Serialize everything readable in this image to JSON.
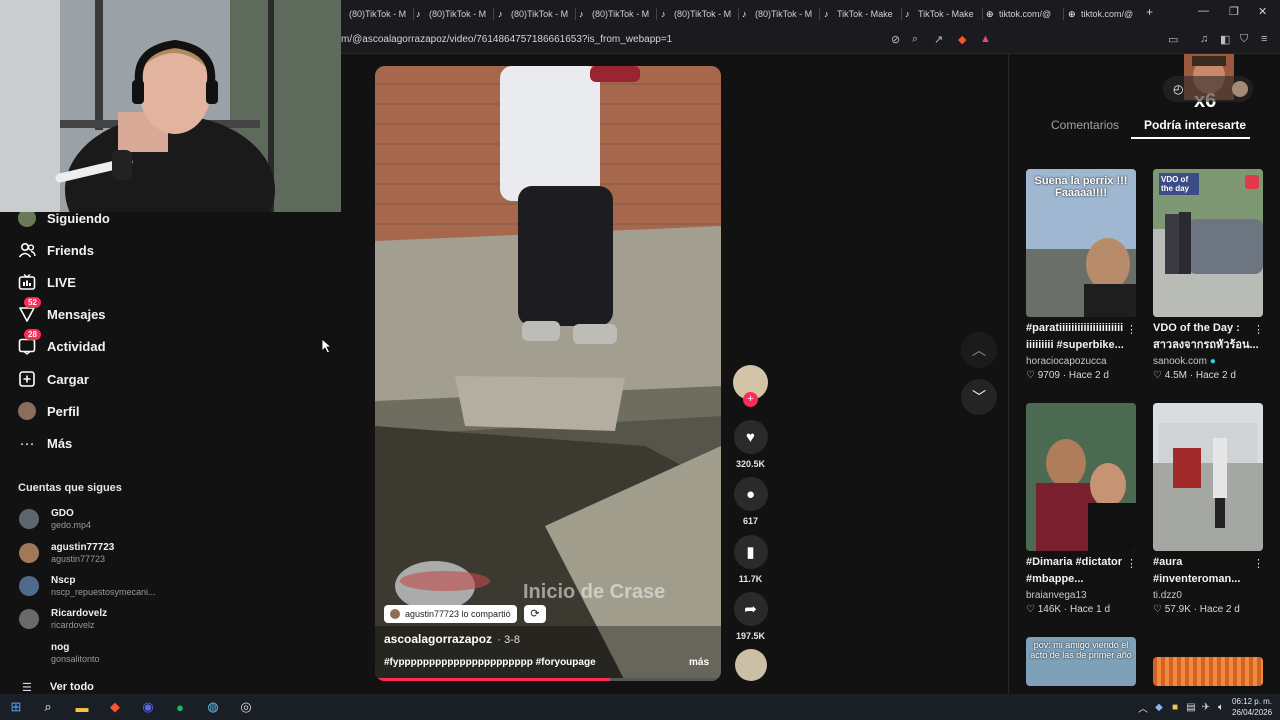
{
  "browser": {
    "tabs": [
      {
        "label": "(80)TikTok - M"
      },
      {
        "label": "(80)TikTok - M"
      },
      {
        "label": "(80)TikTok - M"
      },
      {
        "label": "(80)TikTok - M"
      },
      {
        "label": "(80)TikTok - M"
      },
      {
        "label": "(80)TikTok - M"
      },
      {
        "label": "TikTok - Make"
      },
      {
        "label": "TikTok - Make"
      },
      {
        "label": "tiktok.com/@"
      },
      {
        "label": "tiktok.com/@"
      }
    ],
    "new_tab": "+",
    "url": "m/@ascoalagorrazapoz/video/7614864757186661653?is_from_webapp=1"
  },
  "sidebar": {
    "items": [
      {
        "label": "Siguiendo",
        "icon": "avatar"
      },
      {
        "label": "Friends",
        "icon": "friends-icon"
      },
      {
        "label": "LIVE",
        "icon": "live-icon"
      },
      {
        "label": "Mensajes",
        "icon": "messages-icon",
        "badge": "52"
      },
      {
        "label": "Actividad",
        "icon": "activity-icon",
        "badge": "28"
      },
      {
        "label": "Cargar",
        "icon": "upload-icon"
      },
      {
        "label": "Perfil",
        "icon": "profile-avatar"
      },
      {
        "label": "Más",
        "icon": "more-icon"
      }
    ],
    "following_title": "Cuentas que sigues",
    "accounts": [
      {
        "name": "GDO",
        "handle": "gedo.mp4"
      },
      {
        "name": "agustin77723",
        "handle": "agustin77723"
      },
      {
        "name": "Nscp",
        "handle": "nscp_repuestosymecani..."
      },
      {
        "name": "Ricardovelz",
        "handle": "ricardovelz"
      },
      {
        "name": "nog",
        "handle": "gonsalitonto"
      }
    ],
    "see_all": "Ver todo"
  },
  "video": {
    "overlay_text": "Inicio de Crase",
    "shared_by": "agustin77723 lo compartió",
    "author": "ascoalagorrazapoz",
    "date": "· 3-8",
    "caption": "#fypppppppppppppppppppppp #foryoupage",
    "more": "más",
    "progress": 0.68
  },
  "actions": {
    "likes": "320.5K",
    "comments": "617",
    "saves": "11.7K",
    "shares": "197.5K"
  },
  "right_panel": {
    "tab_comments": "Comentarios",
    "tab_suggested": "Podría interesarte",
    "multiplier": "x6",
    "cards": [
      {
        "title": "#paratiiiiiiiiiiiiiiiiiiiii",
        "title2": "iiiiiiiii #superbike...",
        "user": "horaciocapozucca",
        "likes": "9709",
        "time": "Hace 2 d",
        "thumb_text": "Suena la perrix !!! Faaaaa!!!!"
      },
      {
        "title": "VDO of the Day :",
        "title2": "สาวลงจากรถหัวร้อน...",
        "user": "sanook.com",
        "likes": "4.5M",
        "time": "Hace 2 d",
        "thumb_text": "VDO of the day"
      },
      {
        "title": "#Dimaria #dictator",
        "title2": "#mbappe...",
        "user": "braianvega13",
        "likes": "146K",
        "time": "Hace 1 d",
        "thumb_text": ""
      },
      {
        "title": "#aura",
        "title2": "#inventeroman...",
        "user": "ti.dzz0",
        "likes": "57.9K",
        "time": "Hace 2 d",
        "thumb_text": ""
      },
      {
        "title": "",
        "title2": "",
        "user": "",
        "likes": "",
        "time": "",
        "thumb_text": "pov: mi amigo viendo el acto de las de primer año"
      },
      {
        "title": "",
        "title2": "",
        "user": "",
        "likes": "",
        "time": "",
        "thumb_text": ""
      }
    ]
  },
  "taskbar": {
    "time": "06:12 p. m.",
    "date": "26/04/2026"
  },
  "colors": {
    "accent": "#fe2c55",
    "background": "#121212",
    "taskbar": "#1a1f26"
  }
}
